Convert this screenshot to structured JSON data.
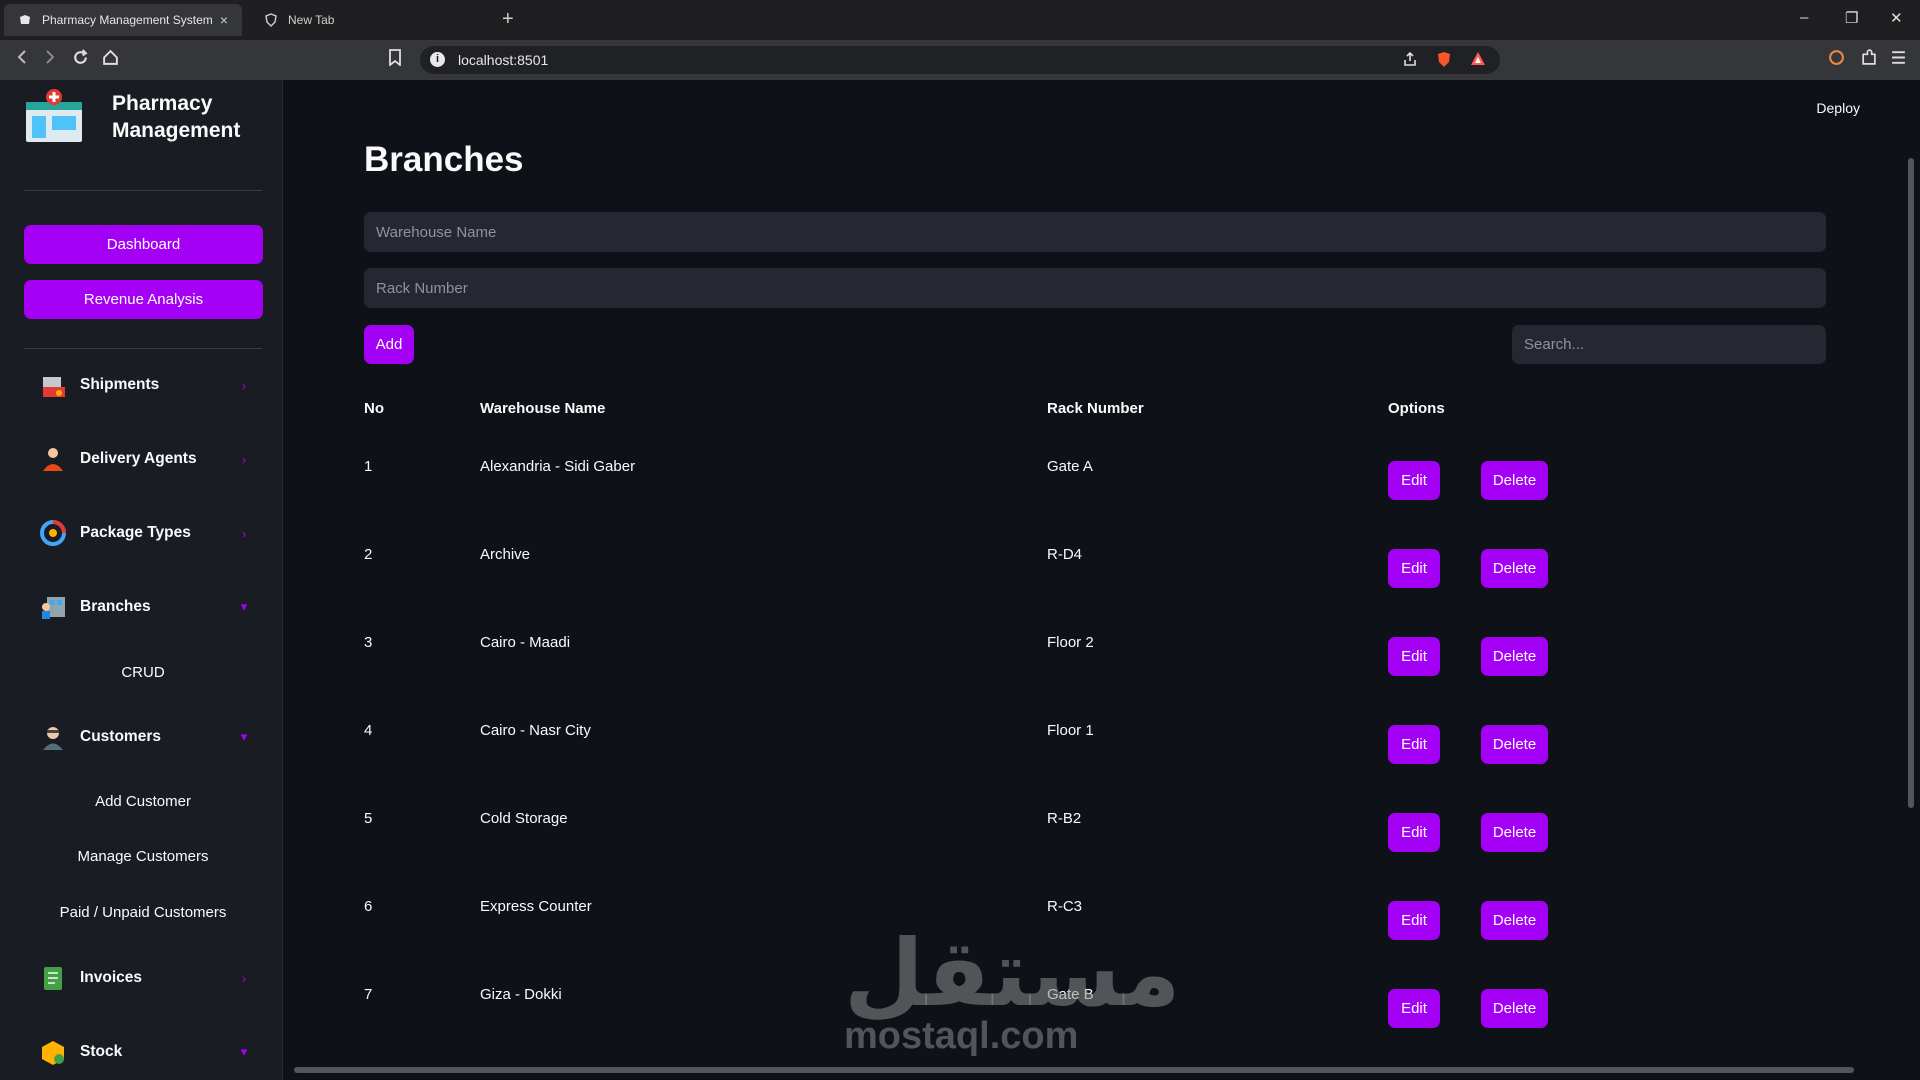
{
  "browser": {
    "tabs": [
      {
        "title": "Pharmacy Management System",
        "close": "×"
      },
      {
        "title": "New Tab"
      }
    ],
    "new_tab": "+",
    "window": {
      "minimize": "–",
      "restore": "❐",
      "close": "✕"
    },
    "url": "localhost:8501"
  },
  "sidebar": {
    "app_name": "Pharmacy Management",
    "buttons": [
      {
        "label": "Dashboard"
      },
      {
        "label": "Revenue Analysis"
      }
    ],
    "menu": [
      {
        "label": "Shipments",
        "icon": "shipment-icon",
        "expanded": false,
        "arrow": "›"
      },
      {
        "label": "Delivery Agents",
        "icon": "delivery-agent-icon",
        "expanded": false,
        "arrow": "›"
      },
      {
        "label": "Package Types",
        "icon": "package-types-icon",
        "expanded": false,
        "arrow": "›"
      },
      {
        "label": "Branches",
        "icon": "branches-icon",
        "expanded": true,
        "arrow": "▾",
        "sub": [
          "CRUD"
        ]
      },
      {
        "label": "Customers",
        "icon": "customers-icon",
        "expanded": true,
        "arrow": "▾",
        "sub": [
          "Add Customer",
          "Manage Customers",
          "Paid / Unpaid Customers"
        ]
      },
      {
        "label": "Invoices",
        "icon": "invoices-icon",
        "expanded": false,
        "arrow": "›"
      },
      {
        "label": "Stock",
        "icon": "stock-icon",
        "expanded": true,
        "arrow": "▾"
      }
    ]
  },
  "main": {
    "deploy": "Deploy",
    "title": "Branches",
    "warehouse_placeholder": "Warehouse Name",
    "rack_placeholder": "Rack Number",
    "add_label": "Add",
    "search_placeholder": "Search...",
    "columns": [
      "No",
      "Warehouse Name",
      "Rack Number",
      "Options"
    ],
    "rows": [
      {
        "no": "1",
        "warehouse": "Alexandria - Sidi Gaber",
        "rack": "Gate A"
      },
      {
        "no": "2",
        "warehouse": "Archive",
        "rack": "R-D4"
      },
      {
        "no": "3",
        "warehouse": "Cairo - Maadi",
        "rack": "Floor 2"
      },
      {
        "no": "4",
        "warehouse": "Cairo - Nasr City",
        "rack": "Floor 1"
      },
      {
        "no": "5",
        "warehouse": "Cold Storage",
        "rack": "R-B2"
      },
      {
        "no": "6",
        "warehouse": "Express Counter",
        "rack": "R-C3"
      },
      {
        "no": "7",
        "warehouse": "Giza - Dokki",
        "rack": "Gate B"
      }
    ],
    "edit_label": "Edit",
    "delete_label": "Delete",
    "watermark_ar": "مستقل",
    "watermark_en": "mostaql.com"
  },
  "colors": {
    "accent": "#a300f5",
    "background": "#0e1117",
    "sidebar": "#1a1c24",
    "input": "#262730"
  }
}
